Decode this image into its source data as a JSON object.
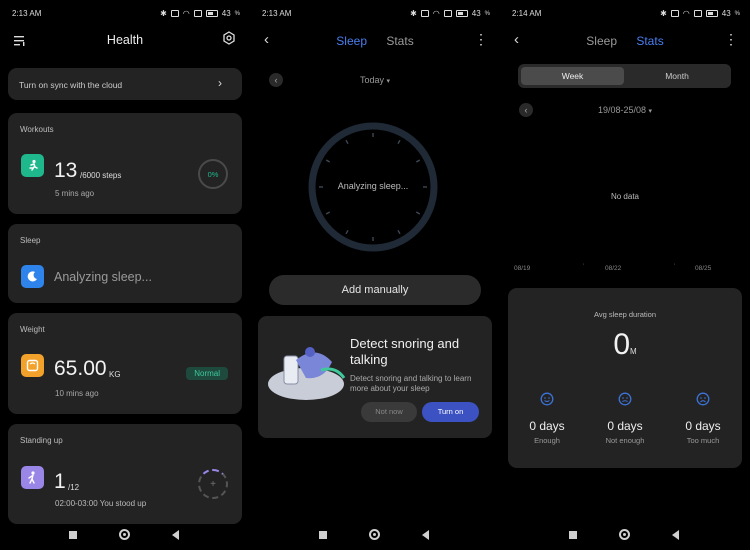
{
  "colors": {
    "accent": "#4a7ef0",
    "card": "#232323",
    "workouts": "#1fb78c",
    "sleep": "#2e84ea",
    "weight": "#f2a22a",
    "standing": "#9a86e6",
    "normal_badge": "#1e7860"
  },
  "status": {
    "s1_time": "2:13 AM",
    "s2_time": "2:13 AM",
    "s3_time": "2:14 AM",
    "battery": "43"
  },
  "health": {
    "title": "Health",
    "sync_text": "Turn on sync with the cloud",
    "workouts": {
      "label": "Workouts",
      "value": "13",
      "unit": "/6000 steps",
      "time": "5 mins ago",
      "progress": "0%"
    },
    "sleep": {
      "label": "Sleep",
      "status": "Analyzing sleep..."
    },
    "weight": {
      "label": "Weight",
      "value": "65.00",
      "unit": "KG",
      "time": "10 mins ago",
      "badge": "Normal"
    },
    "standing": {
      "label": "Standing up",
      "value": "1",
      "unit": "/12",
      "detail": "02:00-03:00  You stood up"
    }
  },
  "sleep_screen": {
    "tab_sleep": "Sleep",
    "tab_stats": "Stats",
    "date": "Today",
    "analyzing": "Analyzing sleep...",
    "add_manually": "Add manually",
    "promo_title": "Detect snoring and talking",
    "promo_desc": "Detect snoring and talking to learn more about your sleep",
    "not_now": "Not now",
    "turn_on": "Turn on"
  },
  "stats_screen": {
    "tab_sleep": "Sleep",
    "tab_stats": "Stats",
    "week": "Week",
    "month": "Month",
    "date_range": "19/08-25/08",
    "no_data": "No data",
    "axis": [
      "08/19",
      "08/22",
      "08/25"
    ],
    "avg_label": "Avg sleep duration",
    "avg_value": "0",
    "avg_unit": "M",
    "stats": [
      {
        "value": "0 days",
        "label": "Enough",
        "icon": "smile-icon"
      },
      {
        "value": "0 days",
        "label": "Not enough",
        "icon": "neutral-face-icon"
      },
      {
        "value": "0 days",
        "label": "Too much",
        "icon": "sad-face-icon"
      }
    ]
  }
}
